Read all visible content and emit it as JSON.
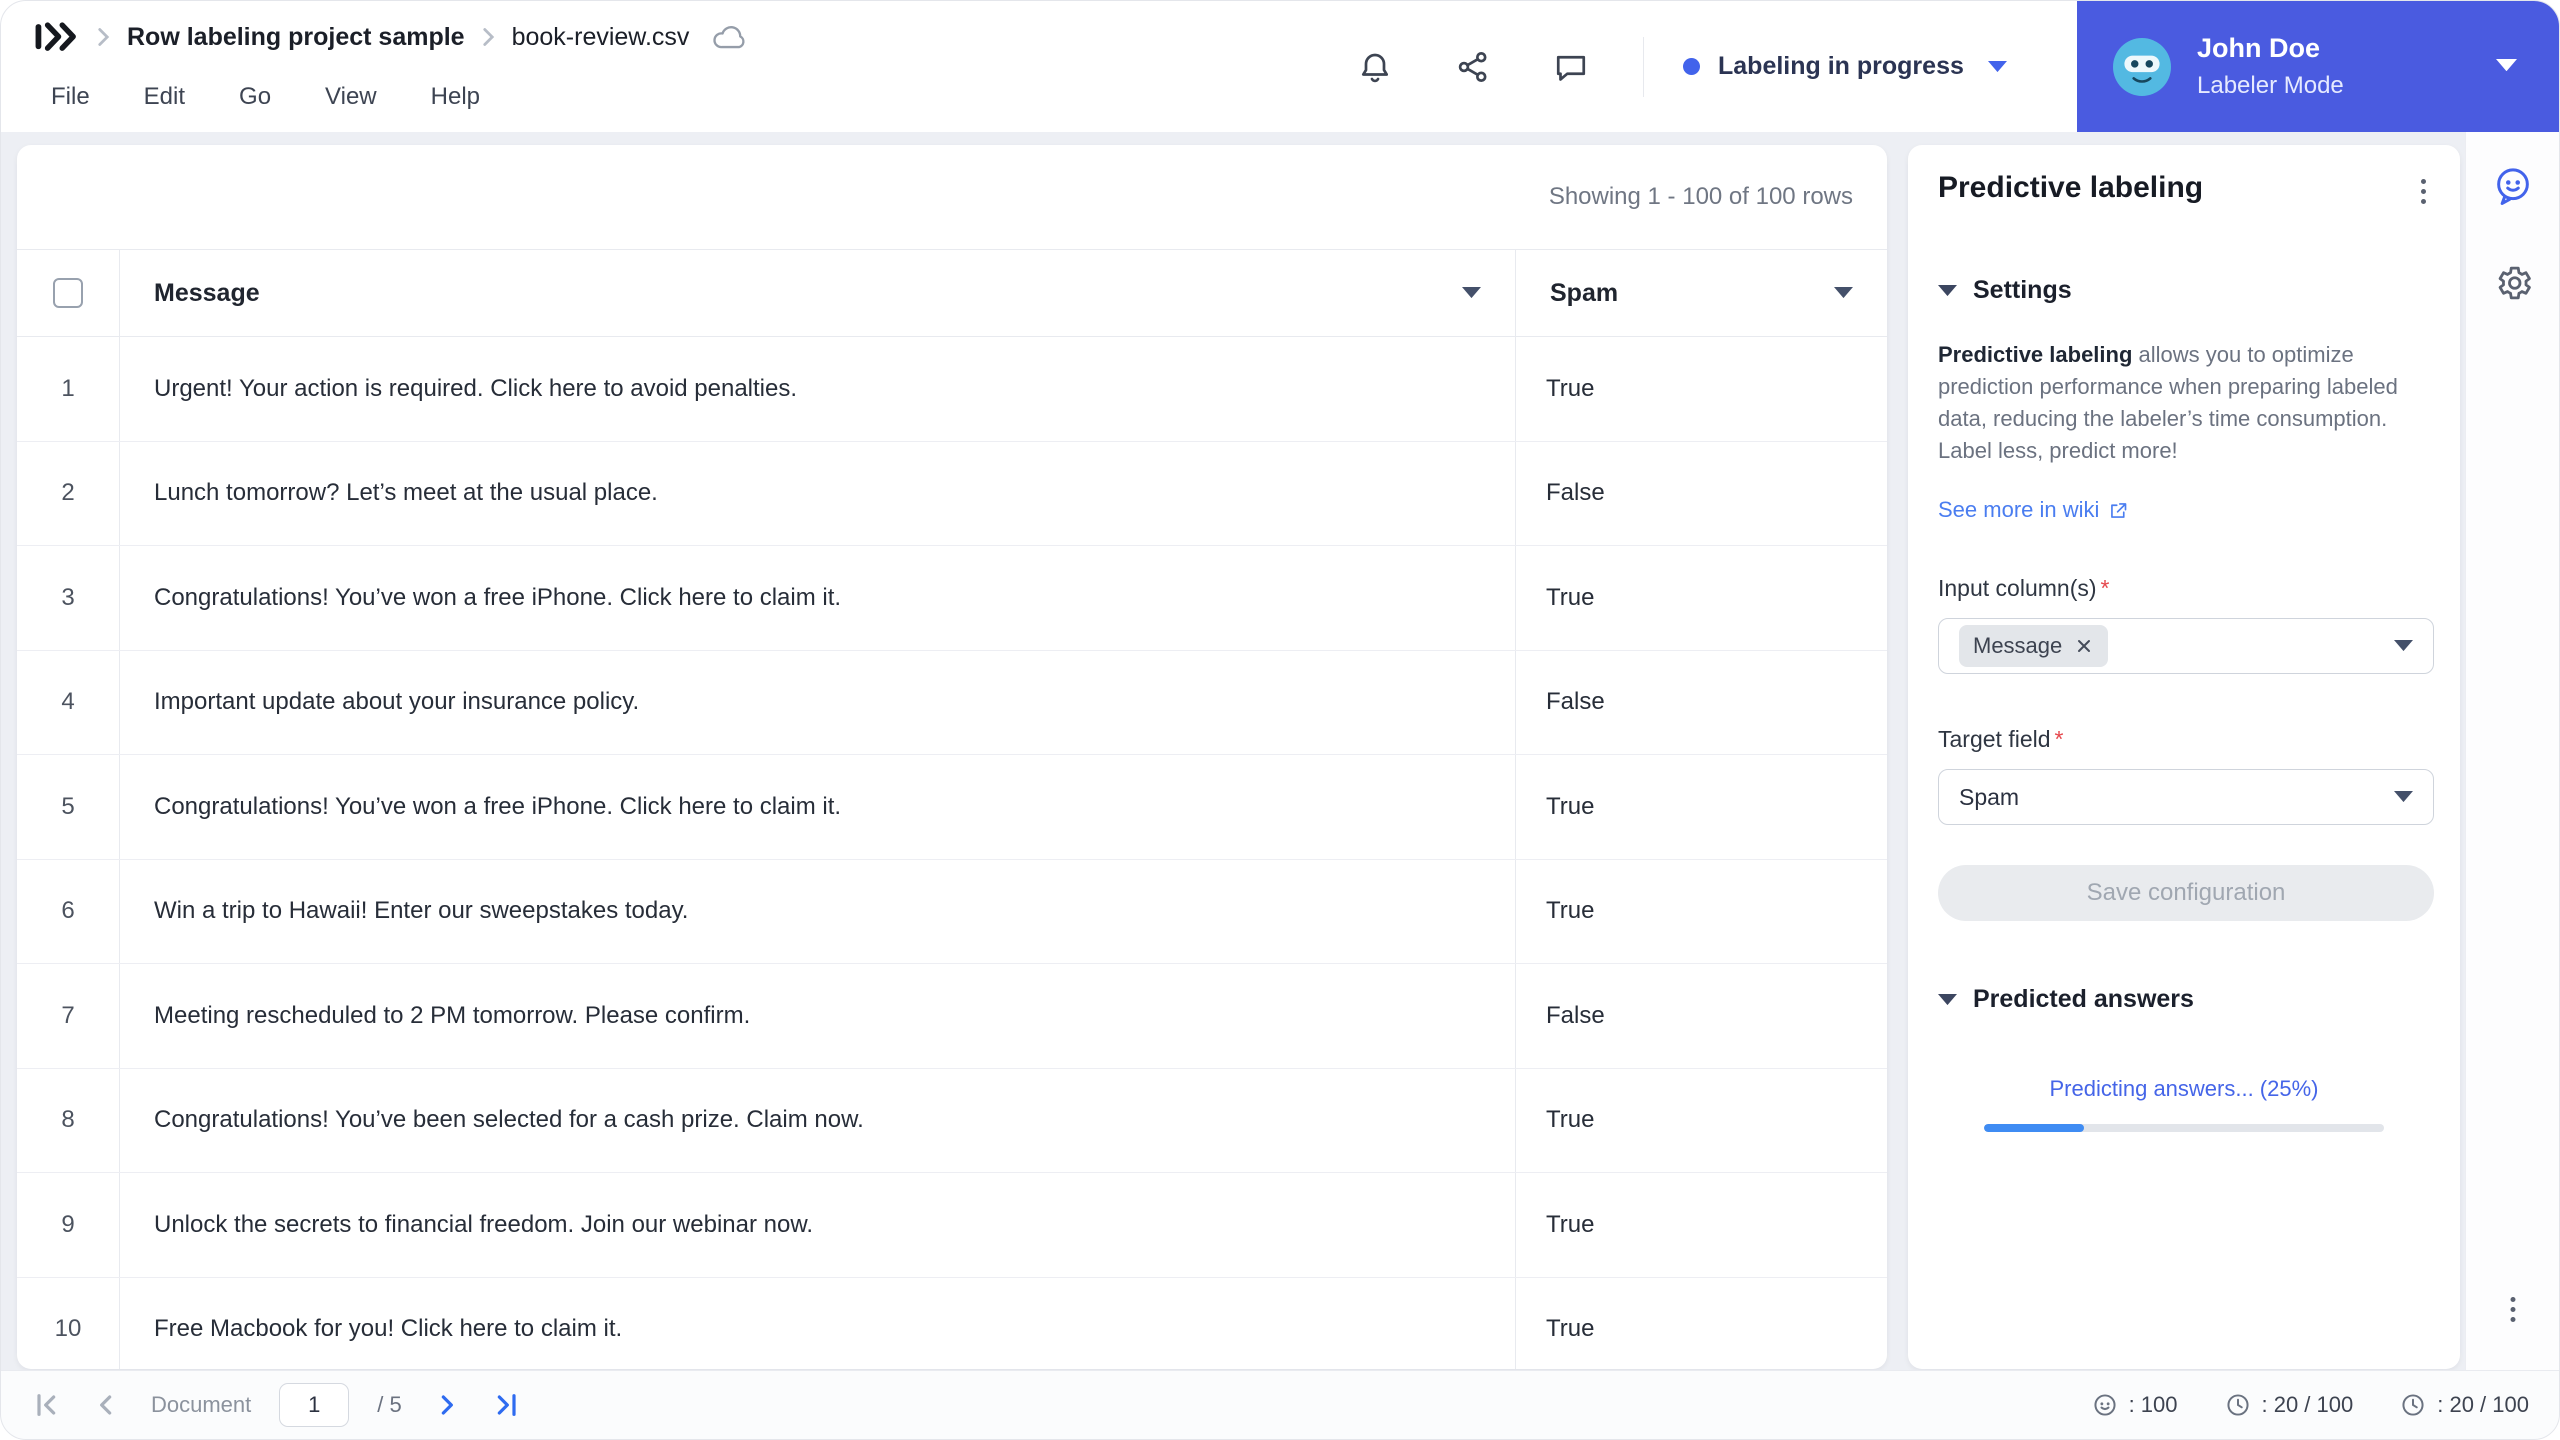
{
  "colors": {
    "badge_accent": "#4a5be0",
    "status_dot": "#4263eb",
    "link_blue": "#4a7df0",
    "progress_blue": "#3f8cf3"
  },
  "header": {
    "breadcrumb": {
      "project": "Row labeling project sample",
      "file": "book-review.csv"
    },
    "menu": [
      "File",
      "Edit",
      "Go",
      "View",
      "Help"
    ],
    "status_label": "Labeling in progress",
    "user": {
      "name": "John Doe",
      "mode": "Labeler Mode"
    }
  },
  "table": {
    "showing": "Showing 1 - 100 of 100 rows",
    "columns": {
      "message": "Message",
      "spam": "Spam"
    },
    "rows": [
      {
        "n": "1",
        "message": "Urgent! Your action is required. Click here to avoid penalties.",
        "spam": "True"
      },
      {
        "n": "2",
        "message": "Lunch tomorrow? Let’s meet at the usual place.",
        "spam": "False"
      },
      {
        "n": "3",
        "message": "Congratulations! You’ve won a free iPhone. Click here to claim it.",
        "spam": "True"
      },
      {
        "n": "4",
        "message": "Important update about your insurance policy.",
        "spam": "False"
      },
      {
        "n": "5",
        "message": "Congratulations! You’ve won a free iPhone. Click here to claim it.",
        "spam": "True"
      },
      {
        "n": "6",
        "message": "Win a trip to Hawaii! Enter our sweepstakes today.",
        "spam": "True"
      },
      {
        "n": "7",
        "message": "Meeting rescheduled to 2 PM tomorrow. Please confirm.",
        "spam": "False"
      },
      {
        "n": "8",
        "message": "Congratulations! You’ve been selected for a cash prize. Claim now.",
        "spam": "True"
      },
      {
        "n": "9",
        "message": "Unlock the secrets to financial freedom. Join our webinar now.",
        "spam": "True"
      },
      {
        "n": "10",
        "message": "Free Macbook for you! Click here to claim it.",
        "spam": "True"
      }
    ]
  },
  "panel": {
    "title": "Predictive labeling",
    "settings_header": "Settings",
    "description_bold": "Predictive labeling",
    "description_rest": " allows you to optimize prediction performance when preparing labeled data, reducing the labeler’s time consumption. Label less, predict more!",
    "wiki_link": "See more in wiki",
    "input_label": "Input column(s)",
    "required_mark": "*",
    "input_chip": "Message",
    "target_label": "Target field",
    "target_value": "Spam",
    "save_button": "Save configuration",
    "predicted_header": "Predicted answers",
    "progress_text": "Predicting answers... (25%)",
    "progress_percent": 25
  },
  "footer": {
    "document_label": "Document",
    "page_value": "1",
    "page_total": "/ 5",
    "counters": [
      ": 100",
      ": 20 / 100",
      ": 20 / 100"
    ]
  }
}
